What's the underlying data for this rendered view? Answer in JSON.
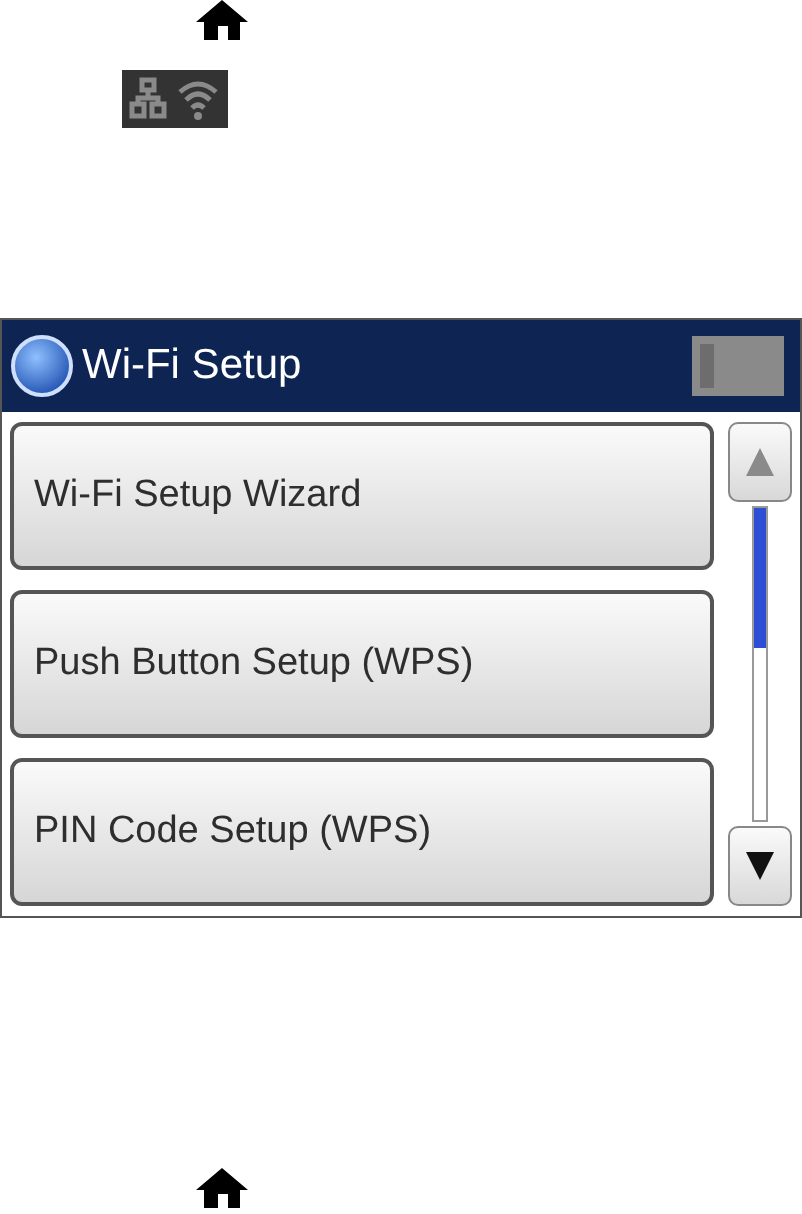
{
  "screen": {
    "title": "Wi-Fi Setup",
    "items": [
      {
        "label": "Wi-Fi Setup Wizard"
      },
      {
        "label": "Push Button Setup (WPS)"
      },
      {
        "label": "PIN Code Setup (WPS)"
      }
    ],
    "scroll_buttons": [
      {
        "kind": "up",
        "disabled": true
      },
      {
        "kind": "down",
        "disabled": false
      }
    ]
  }
}
